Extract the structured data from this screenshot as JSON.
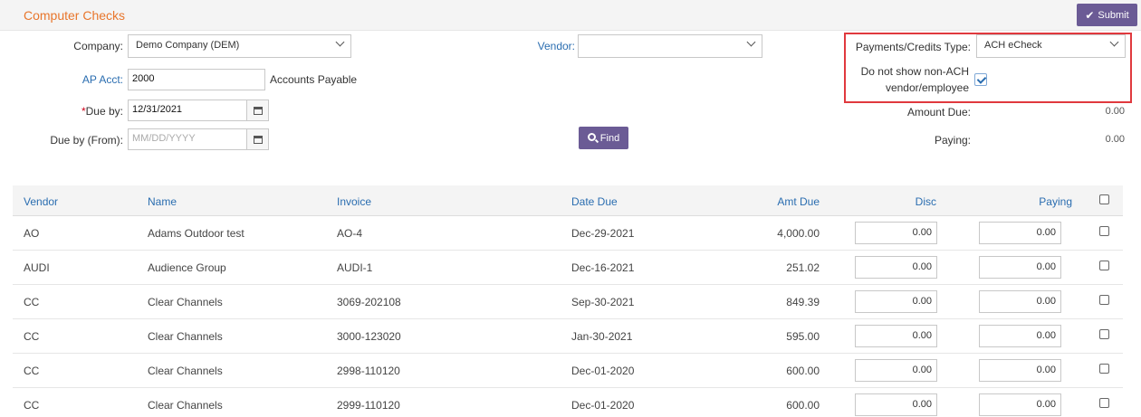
{
  "header": {
    "title": "Computer Checks",
    "submit_label": "Submit"
  },
  "form": {
    "company_label": "Company:",
    "company_value": "Demo Company (DEM)",
    "vendor_label": "Vendor:",
    "vendor_value": "",
    "payments_type_label": "Payments/Credits Type:",
    "payments_type_value": "ACH eCheck",
    "non_ach_label_1": "Do not show non-ACH",
    "non_ach_label_2": "vendor/employee",
    "non_ach_checked": true,
    "ap_acct_label": "AP Acct:",
    "ap_acct_value": "2000",
    "ap_acct_desc": "Accounts Payable",
    "due_by_required": "*",
    "due_by_label": "Due by:",
    "due_by_value": "12/31/2021",
    "due_from_label": "Due by (From):",
    "due_from_placeholder": "MM/DD/YYYY",
    "find_label": "Find",
    "amount_due_label": "Amount Due:",
    "amount_due_value": "0.00",
    "paying_label": "Paying:",
    "paying_value": "0.00"
  },
  "table": {
    "headers": {
      "vendor": "Vendor",
      "name": "Name",
      "invoice": "Invoice",
      "date_due": "Date Due",
      "amt_due": "Amt Due",
      "disc": "Disc",
      "paying": "Paying"
    },
    "rows": [
      {
        "vendor": "AO",
        "name": "Adams Outdoor test",
        "invoice": "AO-4",
        "date_due": "Dec-29-2021",
        "amt_due": "4,000.00",
        "disc": "0.00",
        "paying": "0.00"
      },
      {
        "vendor": "AUDI",
        "name": "Audience Group",
        "invoice": "AUDI-1",
        "date_due": "Dec-16-2021",
        "amt_due": "251.02",
        "disc": "0.00",
        "paying": "0.00"
      },
      {
        "vendor": "CC",
        "name": "Clear Channels",
        "invoice": "3069-202108",
        "date_due": "Sep-30-2021",
        "amt_due": "849.39",
        "disc": "0.00",
        "paying": "0.00"
      },
      {
        "vendor": "CC",
        "name": "Clear Channels",
        "invoice": "3000-123020",
        "date_due": "Jan-30-2021",
        "amt_due": "595.00",
        "disc": "0.00",
        "paying": "0.00"
      },
      {
        "vendor": "CC",
        "name": "Clear Channels",
        "invoice": "2998-110120",
        "date_due": "Dec-01-2020",
        "amt_due": "600.00",
        "disc": "0.00",
        "paying": "0.00"
      },
      {
        "vendor": "CC",
        "name": "Clear Channels",
        "invoice": "2999-110120",
        "date_due": "Dec-01-2020",
        "amt_due": "600.00",
        "disc": "0.00",
        "paying": "0.00"
      }
    ]
  },
  "icons": {
    "submit": "checkmark-icon",
    "find": "search-icon",
    "date": "calendar-icon",
    "dropdown": "chevron-down-icon"
  },
  "colors": {
    "accent": "#6b5b95",
    "title": "#e8762c",
    "link": "#2a6db0",
    "highlight": "#e0393e"
  }
}
